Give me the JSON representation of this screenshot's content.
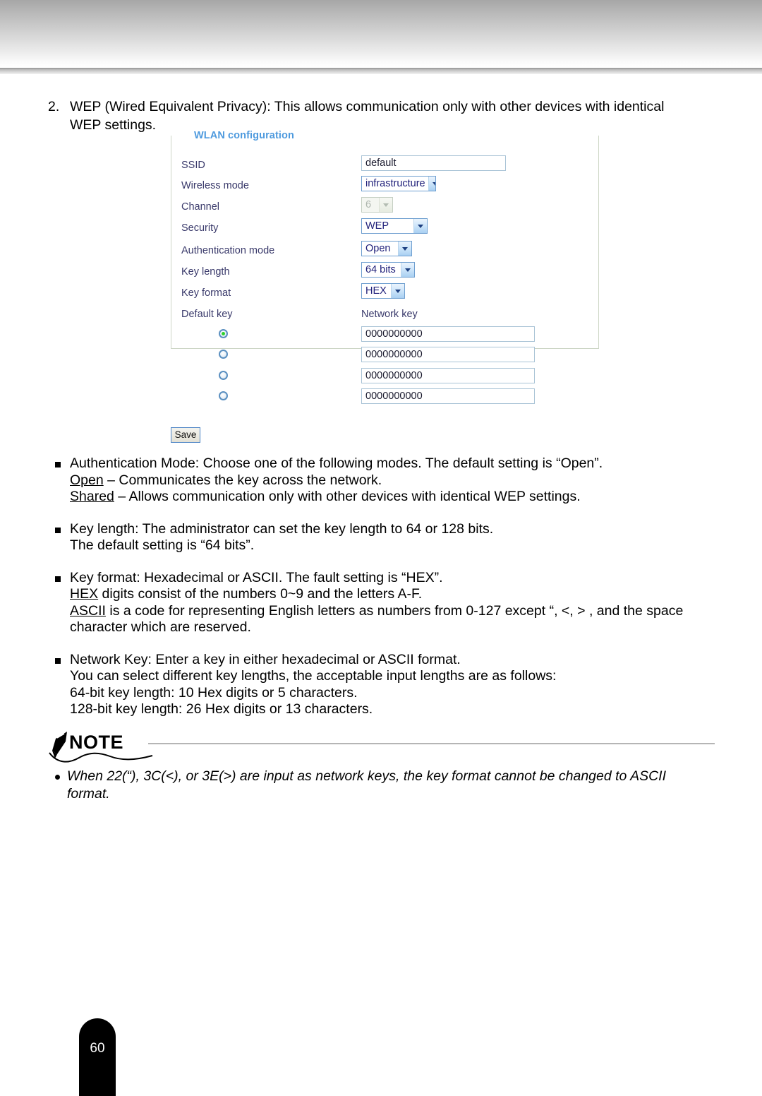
{
  "document": {
    "page_number": "60"
  },
  "step": {
    "number": "2.",
    "line1": "WEP (Wired Equivalent Privacy): This allows communication only with other devices with identical",
    "line2": "WEP settings."
  },
  "wlan_form": {
    "legend": "WLAN configuration",
    "ssid": {
      "label": "SSID",
      "value": "default"
    },
    "wireless_mode": {
      "label": "Wireless mode",
      "value": "infrastructure"
    },
    "channel": {
      "label": "Channel",
      "value": "6",
      "disabled": true
    },
    "security": {
      "label": "Security",
      "value": "WEP"
    },
    "authentication_mode": {
      "label": "Authentication mode",
      "value": "Open"
    },
    "key_length": {
      "label": "Key length",
      "value": "64 bits"
    },
    "key_format": {
      "label": "Key format",
      "value": "HEX"
    },
    "default_key_label": "Default key",
    "network_key_label": "Network key",
    "keys": [
      {
        "selected": true,
        "value": "0000000000"
      },
      {
        "selected": false,
        "value": "0000000000"
      },
      {
        "selected": false,
        "value": "0000000000"
      },
      {
        "selected": false,
        "value": "0000000000"
      }
    ],
    "save_button": "Save",
    "colors": {
      "legend": "#4e9ade",
      "label": "#3a3a6b",
      "select_border": "#6f9fd0",
      "panel_border": "#cdd6c6",
      "radio_selected_dot": "#2ed12e"
    }
  },
  "bullets": [
    {
      "lines": [
        "Authentication Mode: Choose one of the following modes. The default setting is “Open”.",
        "Open – Communicates the key across the network.",
        "Shared – Allows communication only with other devices with identical WEP settings."
      ],
      "underlined": [
        "Open",
        "Shared"
      ]
    },
    {
      "lines": [
        "Key length: The administrator can set the key length to 64 or 128 bits.",
        "The default setting is “64 bits”."
      ],
      "underlined": []
    },
    {
      "lines": [
        "Key format: Hexadecimal or ASCII. The fault setting is “HEX”.",
        "HEX digits consist of the numbers 0~9 and the letters A-F.",
        "ASCII is a code for representing English letters as numbers from 0-127 except “, <, > , and the space",
        "character which are reserved."
      ],
      "underlined": [
        "HEX",
        "ASCII"
      ]
    },
    {
      "lines": [
        "Network Key: Enter a key in either hexadecimal or ASCII format.",
        "You can select different key lengths, the acceptable input lengths are as follows:",
        "64-bit key length: 10 Hex digits or 5 characters.",
        "128-bit key length: 26 Hex digits or 13 characters."
      ],
      "underlined": []
    }
  ],
  "note": {
    "title": "NOTE",
    "items": [
      {
        "line1": "When 22(“), 3C(<), or 3E(>) are input as network keys, the key format cannot be changed to ASCII",
        "line2": "format."
      }
    ]
  }
}
